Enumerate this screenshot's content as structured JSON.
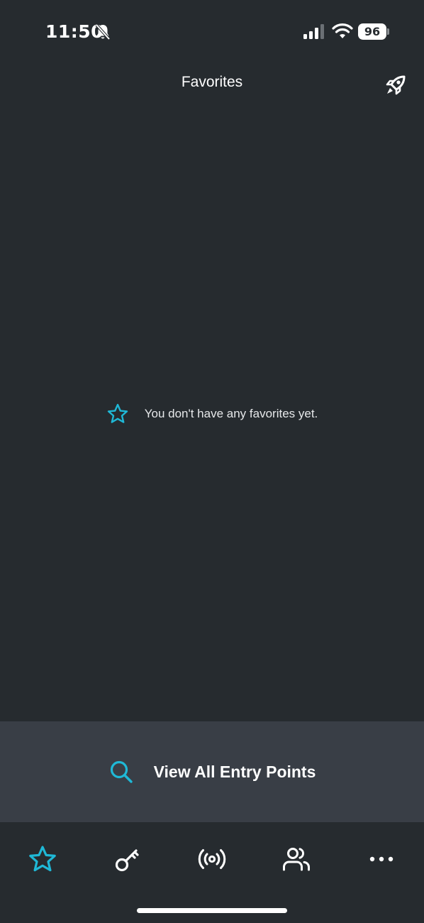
{
  "status_bar": {
    "time": "11:50",
    "battery": "96",
    "icons": [
      "bell-off-icon",
      "cellular-signal-icon",
      "wifi-icon",
      "battery-icon"
    ]
  },
  "nav": {
    "title": "Favorites",
    "right_icon": "rocket-icon"
  },
  "empty_state": {
    "icon": "star-outline-icon",
    "message": "You don't have any favorites yet."
  },
  "entry_points": {
    "icon": "search-icon",
    "label": "View All Entry Points"
  },
  "tab_bar": {
    "tabs": [
      {
        "icon": "star-icon",
        "active": true
      },
      {
        "icon": "key-icon",
        "active": false
      },
      {
        "icon": "broadcast-icon",
        "active": false
      },
      {
        "icon": "users-icon",
        "active": false
      },
      {
        "icon": "more-icon",
        "active": false
      }
    ]
  },
  "colors": {
    "background": "#262b2f",
    "bar": "#393e46",
    "accent": "#1fb8d6",
    "text": "#ffffff"
  }
}
